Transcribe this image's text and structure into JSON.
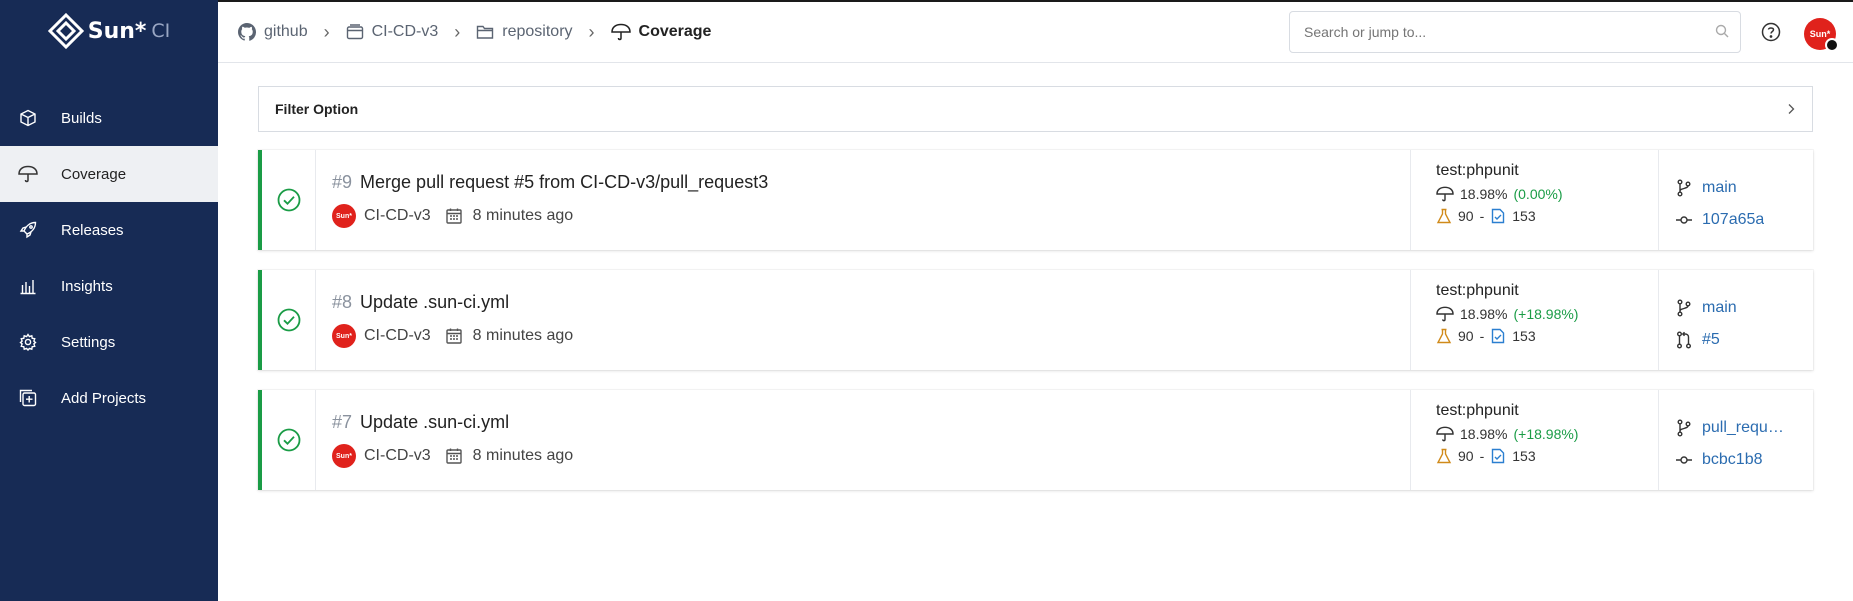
{
  "brand": {
    "name": "Sun*",
    "suffix": "CI",
    "accent": "#e0221c",
    "sidebar_bg": "#172b55"
  },
  "sidebar": {
    "items": [
      {
        "label": "Builds",
        "icon": "cube-icon"
      },
      {
        "label": "Coverage",
        "icon": "umbrella-icon",
        "active": true
      },
      {
        "label": "Releases",
        "icon": "rocket-icon"
      },
      {
        "label": "Insights",
        "icon": "bar-chart-icon"
      },
      {
        "label": "Settings",
        "icon": "gear-icon"
      },
      {
        "label": "Add Projects",
        "icon": "add-project-icon"
      }
    ]
  },
  "header": {
    "breadcrumb": [
      {
        "label": "github",
        "icon": "github-icon"
      },
      {
        "label": "CI-CD-v3",
        "icon": "window-icon"
      },
      {
        "label": "repository",
        "icon": "folder-icon"
      },
      {
        "label": "Coverage",
        "icon": "umbrella-icon"
      }
    ],
    "search_placeholder": "Search or jump to...",
    "avatar_text": "Sun*"
  },
  "filter": {
    "label": "Filter Option"
  },
  "builds": [
    {
      "number": "#9",
      "title": "Merge pull request #5 from CI-CD-v3/pull_request3",
      "repo": "CI-CD-v3",
      "time": "8 minutes ago",
      "avatar_text": "Sun*",
      "job": "test:phpunit",
      "coverage": "18.98%",
      "delta": "(0.00%)",
      "tests": "90",
      "files": "153",
      "branch": "main",
      "ref": "107a65a",
      "ref_type": "commit-icon"
    },
    {
      "number": "#8",
      "title": "Update .sun-ci.yml",
      "repo": "CI-CD-v3",
      "time": "8 minutes ago",
      "avatar_text": "Sun*",
      "job": "test:phpunit",
      "coverage": "18.98%",
      "delta": "(+18.98%)",
      "tests": "90",
      "files": "153",
      "branch": "main",
      "ref": "#5",
      "ref_type": "pull-request-icon"
    },
    {
      "number": "#7",
      "title": "Update .sun-ci.yml",
      "repo": "CI-CD-v3",
      "time": "8 minutes ago",
      "avatar_text": "Sun*",
      "job": "test:phpunit",
      "coverage": "18.98%",
      "delta": "(+18.98%)",
      "tests": "90",
      "files": "153",
      "branch": "pull_reque…",
      "ref": "bcbc1b8",
      "ref_type": "commit-icon"
    }
  ]
}
